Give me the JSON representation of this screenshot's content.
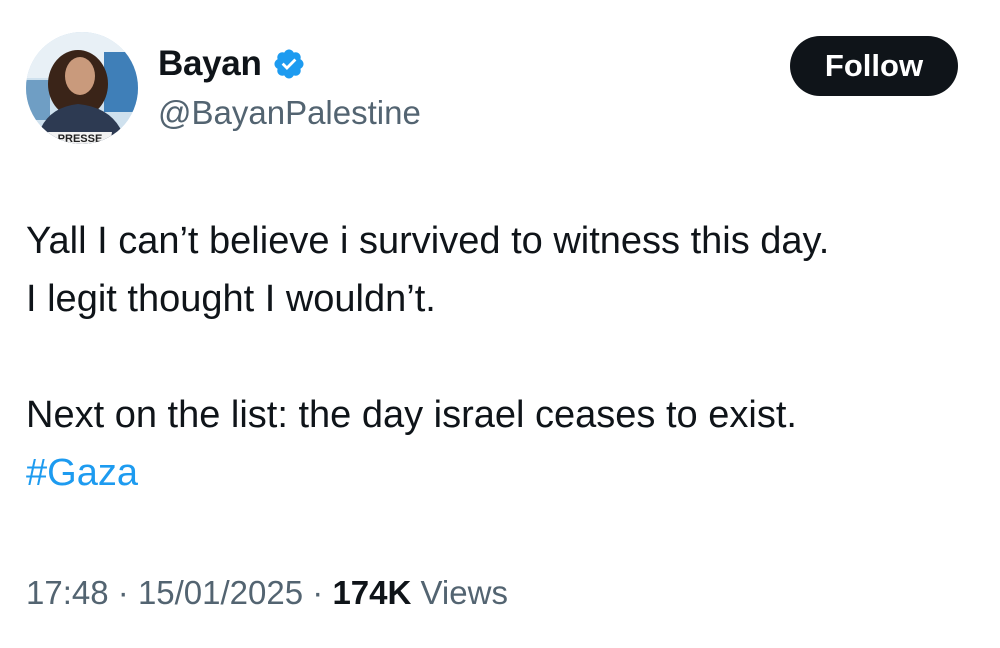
{
  "author": {
    "display_name": "Bayan",
    "handle": "@BayanPalestine",
    "verified": true,
    "avatar_vest_text": "PRESSE"
  },
  "follow_button": {
    "label": "Follow"
  },
  "tweet": {
    "lines": [
      "Yall I can’t believe i survived to witness this day.",
      "I legit thought I wouldn’t.",
      "Next on the list: the day israel ceases to exist."
    ],
    "hashtag": "#Gaza"
  },
  "meta": {
    "time": "17:48",
    "separator": "·",
    "date": "15/01/2025",
    "views_count": "174K",
    "views_label": "Views"
  },
  "colors": {
    "accent": "#1d9bf0",
    "text": "#0f1419",
    "muted": "#536471",
    "button_bg": "#0f1419"
  }
}
